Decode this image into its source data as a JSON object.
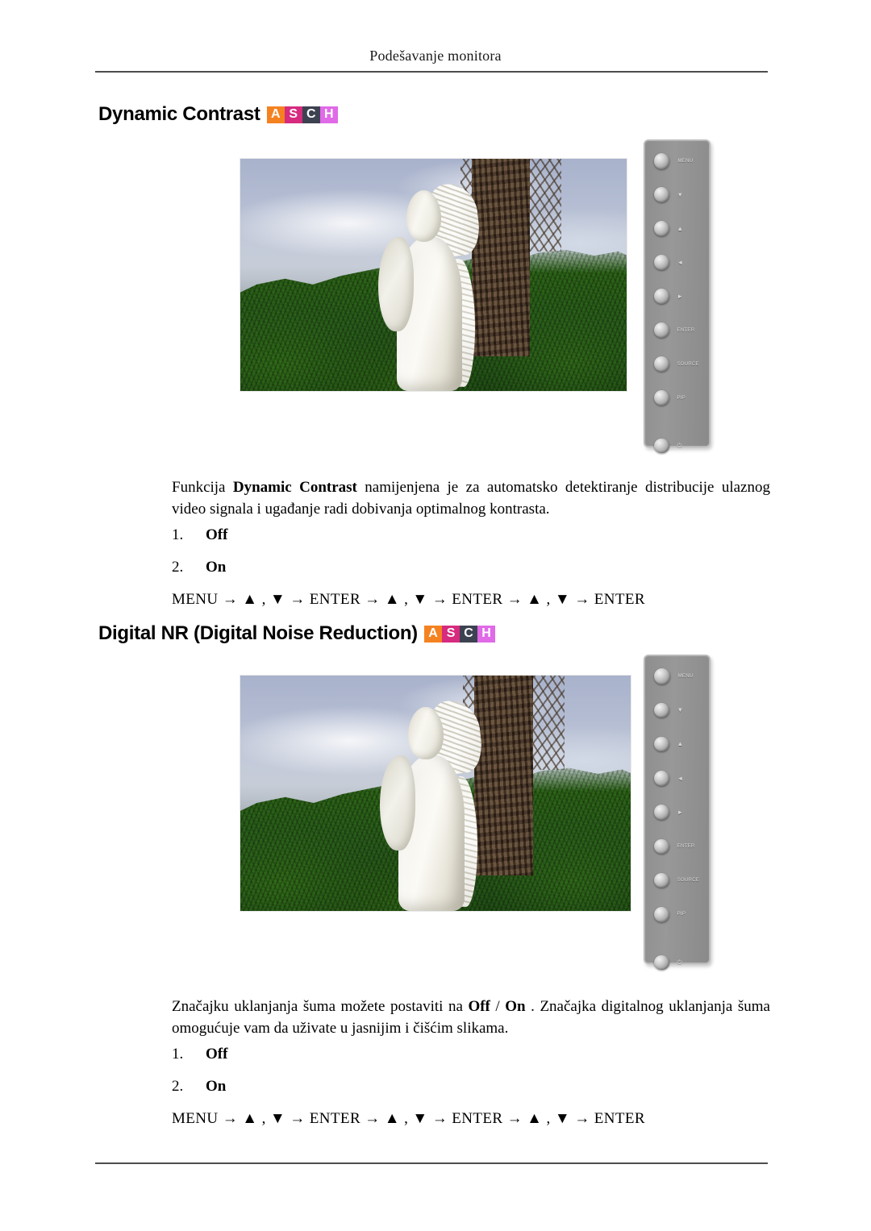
{
  "header": {
    "running_title": "Podešavanje monitora"
  },
  "badge": {
    "letters": [
      "A",
      "S",
      "C",
      "H"
    ],
    "colors": [
      "#f58220",
      "#d62b7e",
      "#3d4251",
      "#e06ae8"
    ]
  },
  "sections": [
    {
      "heading": "Dynamic Contrast",
      "paragraph_pre": "Funkcija ",
      "paragraph_bold": "Dynamic Contrast",
      "paragraph_post": " namijenjena je za automatsko detektiranje distribucije ulaznog video signala i ugađanje radi dobivanja optimalnog kontrasta.",
      "options": [
        {
          "num": "1.",
          "label": "Off"
        },
        {
          "num": "2.",
          "label": "On"
        }
      ],
      "nav_sequence": "MENU → ▲ , ▼ → ENTER → ▲ , ▼ → ENTER → ▲ , ▼ → ENTER"
    },
    {
      "heading": "Digital NR (Digital Noise Reduction)",
      "paragraph_pre": "Značajku uklanjanja šuma možete postaviti na ",
      "paragraph_bold": "Off",
      "paragraph_mid": " / ",
      "paragraph_bold2": "On",
      "paragraph_post": " . Značajka digitalnog uklanjanja šuma omogućuje vam da uživate u jasnijim i čišćim slikama.",
      "options": [
        {
          "num": "1.",
          "label": "Off"
        },
        {
          "num": "2.",
          "label": "On"
        }
      ],
      "nav_sequence": "MENU → ▲ , ▼ → ENTER → ▲ , ▼ → ENTER → ▲ , ▼ → ENTER"
    }
  ],
  "control_panel": {
    "buttons": [
      {
        "label": "MENU",
        "icon": "menu-button"
      },
      {
        "label": "▼",
        "icon": "arrow-down-button"
      },
      {
        "label": "▲",
        "icon": "arrow-up-button"
      },
      {
        "label": "◄",
        "icon": "arrow-left-button"
      },
      {
        "label": "►",
        "icon": "arrow-right-button"
      },
      {
        "label": "ENTER",
        "icon": "enter-button"
      },
      {
        "label": "SOURCE",
        "icon": "source-button"
      },
      {
        "label": "PIP",
        "icon": "pip-button"
      },
      {
        "label": "⏻",
        "icon": "power-button"
      }
    ]
  },
  "figure_alt": "Monitor display showing a white marble statue in front of green foliage and a palm trunk"
}
